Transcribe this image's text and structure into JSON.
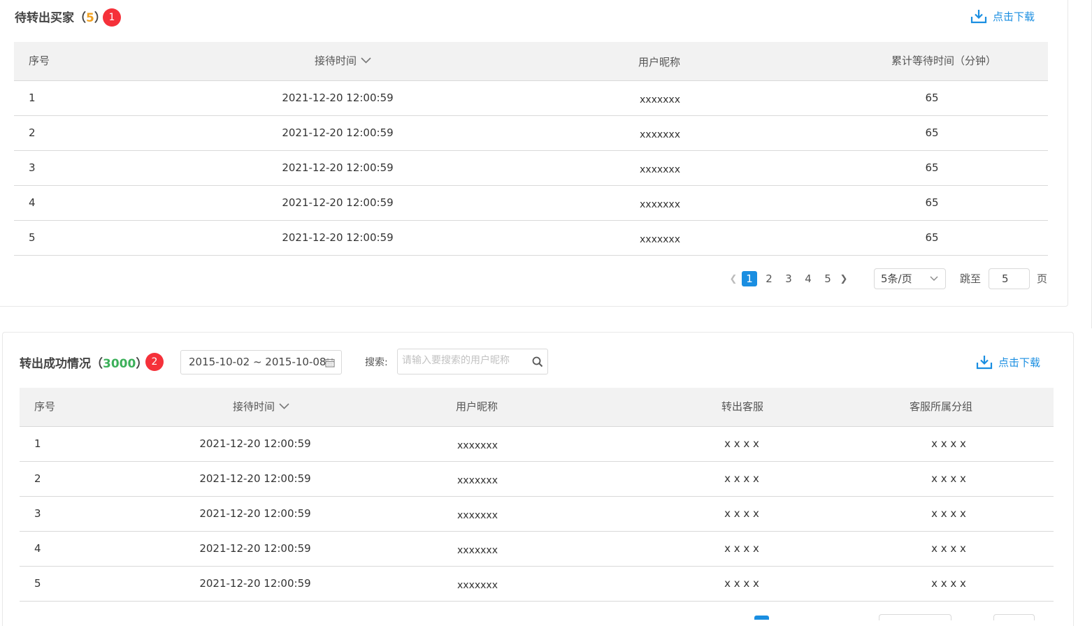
{
  "pending": {
    "title": "待转出买家",
    "count": "5",
    "badge": "1",
    "download_label": "点击下载",
    "columns": [
      "序号",
      "接待时间",
      "用户昵称",
      "累计等待时间（分钟）"
    ],
    "rows": [
      {
        "no": "1",
        "time": "2021-12-20 12:00:59",
        "nick": "xxxxxxx",
        "wait": "65"
      },
      {
        "no": "2",
        "time": "2021-12-20 12:00:59",
        "nick": "xxxxxxx",
        "wait": "65"
      },
      {
        "no": "3",
        "time": "2021-12-20 12:00:59",
        "nick": "xxxxxxx",
        "wait": "65"
      },
      {
        "no": "4",
        "time": "2021-12-20 12:00:59",
        "nick": "xxxxxxx",
        "wait": "65"
      },
      {
        "no": "5",
        "time": "2021-12-20 12:00:59",
        "nick": "xxxxxxx",
        "wait": "65"
      }
    ],
    "pagination": {
      "pages": [
        "1",
        "2",
        "3",
        "4",
        "5"
      ],
      "current_page": "1",
      "page_size": "5条/页",
      "jump_label": "跳至",
      "jump_value": "5",
      "page_suffix": "页"
    }
  },
  "transferred": {
    "title": "转出成功情况",
    "count": "3000",
    "badge": "2",
    "date_range": "2015-10-02 ~ 2015-10-08",
    "search_label": "搜索:",
    "search_placeholder": "请输入要搜索的用户昵称",
    "download_label": "点击下载",
    "columns": [
      "序号",
      "接待时间",
      "用户昵称",
      "转出客服",
      "客服所属分组"
    ],
    "rows": [
      {
        "no": "1",
        "time": "2021-12-20 12:00:59",
        "nick": "xxxxxxx",
        "agent": "x x x x",
        "group": "x x x x"
      },
      {
        "no": "2",
        "time": "2021-12-20 12:00:59",
        "nick": "xxxxxxx",
        "agent": "x x x x",
        "group": "x x x x"
      },
      {
        "no": "3",
        "time": "2021-12-20 12:00:59",
        "nick": "xxxxxxx",
        "agent": "x x x x",
        "group": "x x x x"
      },
      {
        "no": "4",
        "time": "2021-12-20 12:00:59",
        "nick": "xxxxxxx",
        "agent": "x x x x",
        "group": "x x x x"
      },
      {
        "no": "5",
        "time": "2021-12-20 12:00:59",
        "nick": "xxxxxxx",
        "agent": "x x x x",
        "group": "x x x x"
      }
    ]
  },
  "colors": {
    "accent": "#1a8ee1",
    "badge": "#f5313a",
    "count_pending": "#f0a020",
    "count_transferred": "#3cb05a"
  },
  "icons": {
    "download": "download-icon",
    "sort": "chevron-down-icon",
    "calendar": "calendar-icon",
    "search": "search-icon"
  }
}
